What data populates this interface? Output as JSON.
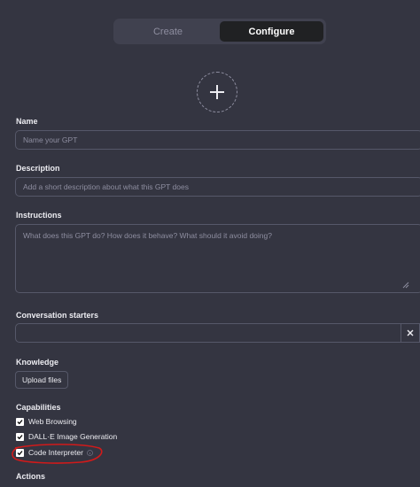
{
  "tabs": [
    {
      "label": "Create",
      "active": false
    },
    {
      "label": "Configure",
      "active": true
    }
  ],
  "name": {
    "label": "Name",
    "placeholder": "Name your GPT"
  },
  "description": {
    "label": "Description",
    "placeholder": "Add a short description about what this GPT does"
  },
  "instructions": {
    "label": "Instructions",
    "placeholder": "What does this GPT do? How does it behave? What should it avoid doing?"
  },
  "conversation_starters": {
    "label": "Conversation starters",
    "value": ""
  },
  "knowledge": {
    "label": "Knowledge",
    "upload_label": "Upload files"
  },
  "capabilities": {
    "label": "Capabilities",
    "items": [
      {
        "label": "Web Browsing",
        "checked": true
      },
      {
        "label": "DALL·E Image Generation",
        "checked": true
      },
      {
        "label": "Code Interpreter",
        "checked": true
      }
    ]
  },
  "actions": {
    "label": "Actions"
  },
  "icons": {
    "add": "plus-icon",
    "resize": "resize-handle-icon",
    "close": "close-icon",
    "check": "checkmark-icon",
    "info": "info-icon"
  },
  "colors": {
    "background": "#343541",
    "tab_bar": "#40414f",
    "active_tab": "#202123",
    "border": "#565869",
    "annotation": "#d11a1a"
  }
}
